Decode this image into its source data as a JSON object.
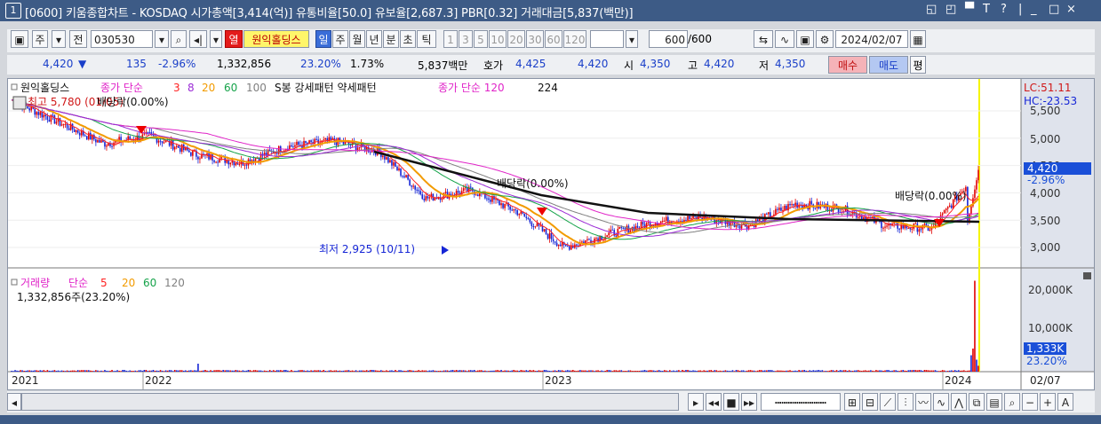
{
  "window": {
    "number": "1",
    "title": "[0600] 키움종합차트 - KOSDAQ 시가총액[3,414(억)] 유통비율[50.0] 유보율[2,687.3] PBR[0.32] 거래대금[5,837(백만)]",
    "controls": [
      "◱",
      "◰",
      "▀",
      "T",
      "?",
      "|",
      "_",
      "□",
      "×"
    ]
  },
  "toolbar": {
    "period_main": "주",
    "prev_label": "전",
    "code": "030530",
    "stock_name": "원익홀딩스",
    "red_label": "열",
    "periods": [
      "일",
      "주",
      "월",
      "년",
      "분",
      "초",
      "틱"
    ],
    "active_period": "일",
    "intervals": [
      "1",
      "3",
      "5",
      "10",
      "20",
      "30",
      "60",
      "120"
    ],
    "count": "600",
    "count_total": "/600",
    "date": "2024/02/07"
  },
  "quote": {
    "price": "4,420",
    "arrow": "▼",
    "change": "135",
    "change_pct": "-2.96%",
    "volume": "1,332,856",
    "volume_ratio": "23.20%",
    "turnover": "1.73%",
    "amount": "5,837백만",
    "ask_label": "호가",
    "ask": "4,425",
    "bid": "4,420",
    "open_label": "시",
    "open": "4,350",
    "high_label": "고",
    "high": "4,420",
    "low_label": "저",
    "low": "4,350",
    "buy_label": "매수",
    "sell_label": "매도",
    "flat_label": "평"
  },
  "price_legend": {
    "name": "원익홀딩스",
    "ma_label": "종가 단순",
    "ma_periods": [
      "3",
      "8",
      "20",
      "60",
      "100"
    ],
    "pattern_label": "S봉 강세패턴 약세패턴",
    "ma2_label": "종가 단순 120",
    "ma2_extra": "224"
  },
  "annotations": {
    "high_label": "최고 5,780 (01/05)",
    "dividend1": "배당락(0.00%)",
    "dividend2": "배당락(0.00%)",
    "dividend3": "배당락(0.00%)",
    "low_label": "최저 2,925 (10/11)"
  },
  "price_axis": {
    "lc": "LC:51.11",
    "hc": "HC:-23.53",
    "ticks": [
      "5,500",
      "5,000",
      "4,500",
      "4,000",
      "3,500",
      "3,000"
    ],
    "current": "4,420",
    "current_pct": "-2.96%"
  },
  "volume_legend": {
    "label": "거래량",
    "ma_label": "단순",
    "ma_periods": [
      "5",
      "20",
      "60",
      "120"
    ],
    "current": "1,332,856주(23.20%)"
  },
  "volume_axis": {
    "ticks": [
      "20,000K",
      "10,000K"
    ],
    "current": "1,333K",
    "current_pct": "23.20%"
  },
  "x_axis": {
    "labels": [
      "2021",
      "2022",
      "2023",
      "2024"
    ],
    "right_label": "02/07"
  },
  "colors": {
    "ma3": "#ff1f1f",
    "ma8": "#9b2bd6",
    "ma20": "#f29b00",
    "ma60": "#16a34a",
    "ma100": "#808080",
    "ma120": "#e024c8",
    "up": "#e00000",
    "down": "#1626d6"
  },
  "chart_data": {
    "type": "line",
    "title": "",
    "x": [
      "2021-01",
      "2021-02",
      "2021-04",
      "2021-06",
      "2021-08",
      "2021-10",
      "2021-12",
      "2022-02",
      "2022-04",
      "2022-06",
      "2022-08",
      "2022-09",
      "2022-10",
      "2022-11",
      "2023-01",
      "2023-03",
      "2023-05",
      "2023-07",
      "2023-09",
      "2023-11",
      "2024-01",
      "2024-02"
    ],
    "series": [
      {
        "name": "close",
        "values": [
          5700,
          5300,
          4900,
          5050,
          4700,
          4550,
          4850,
          4950,
          4750,
          3900,
          4050,
          3650,
          3000,
          3250,
          3470,
          3550,
          3400,
          3800,
          3720,
          3400,
          3350,
          4420
        ]
      }
    ],
    "volume_k": [
      300,
      250,
      200,
      300,
      250,
      200,
      800,
      300,
      250,
      300,
      250,
      200,
      300,
      200,
      250,
      300,
      200,
      250,
      200,
      250,
      300,
      1333
    ],
    "ylim": [
      2800,
      5800
    ],
    "volume_ylim": [
      0,
      22000
    ]
  }
}
